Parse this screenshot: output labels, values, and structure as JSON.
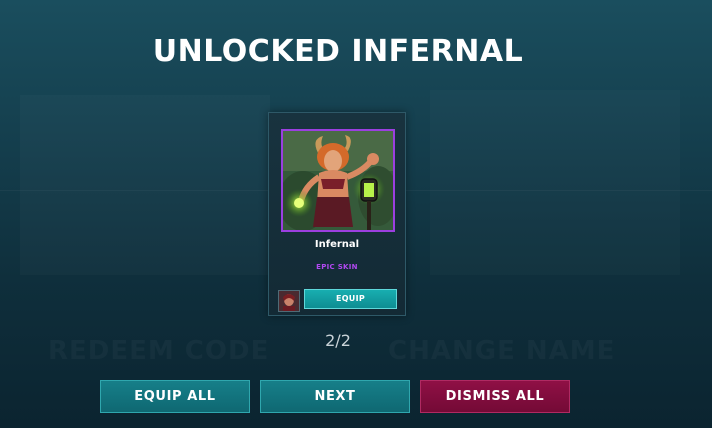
{
  "title": "UNLOCKED INFERNAL",
  "reward_card": {
    "name": "Infernal",
    "rarity": "EPIC SKIN",
    "equip_label": "EQUIP",
    "rarity_color": "#b048f0"
  },
  "background_labels": {
    "left": "REDEEM CODE",
    "right": "CHANGE NAME"
  },
  "counter": "2/2",
  "buttons": {
    "equip_all": "EQUIP ALL",
    "next": "NEXT",
    "dismiss_all": "DISMISS ALL"
  },
  "colors": {
    "accent_teal": "#167f89",
    "dismiss_magenta": "#8f1045",
    "epic_purple": "#9b3fe0"
  }
}
